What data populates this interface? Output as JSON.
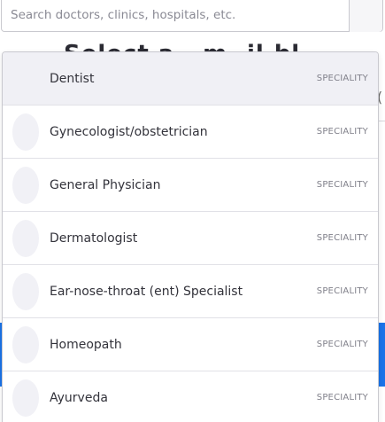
{
  "search": {
    "placeholder": "Search doctors, clinics, hospitals, etc."
  },
  "background": {
    "heading": "Select a ..m..il.bl.",
    "side_text": "("
  },
  "suggestions": [
    {
      "label": "Dentist",
      "badge": "SPECIALITY",
      "active": true
    },
    {
      "label": "Gynecologist/obstetrician",
      "badge": "SPECIALITY"
    },
    {
      "label": "General Physician",
      "badge": "SPECIALITY"
    },
    {
      "label": "Dermatologist",
      "badge": "SPECIALITY"
    },
    {
      "label": "Ear-nose-throat (ent) Specialist",
      "badge": "SPECIALITY"
    },
    {
      "label": "Homeopath",
      "badge": "SPECIALITY"
    },
    {
      "label": "Ayurveda",
      "badge": "SPECIALITY"
    }
  ],
  "colors": {
    "accent": "#1a73e8",
    "active_row": "#f0f0f5",
    "avatar": "#f1f1f6"
  }
}
